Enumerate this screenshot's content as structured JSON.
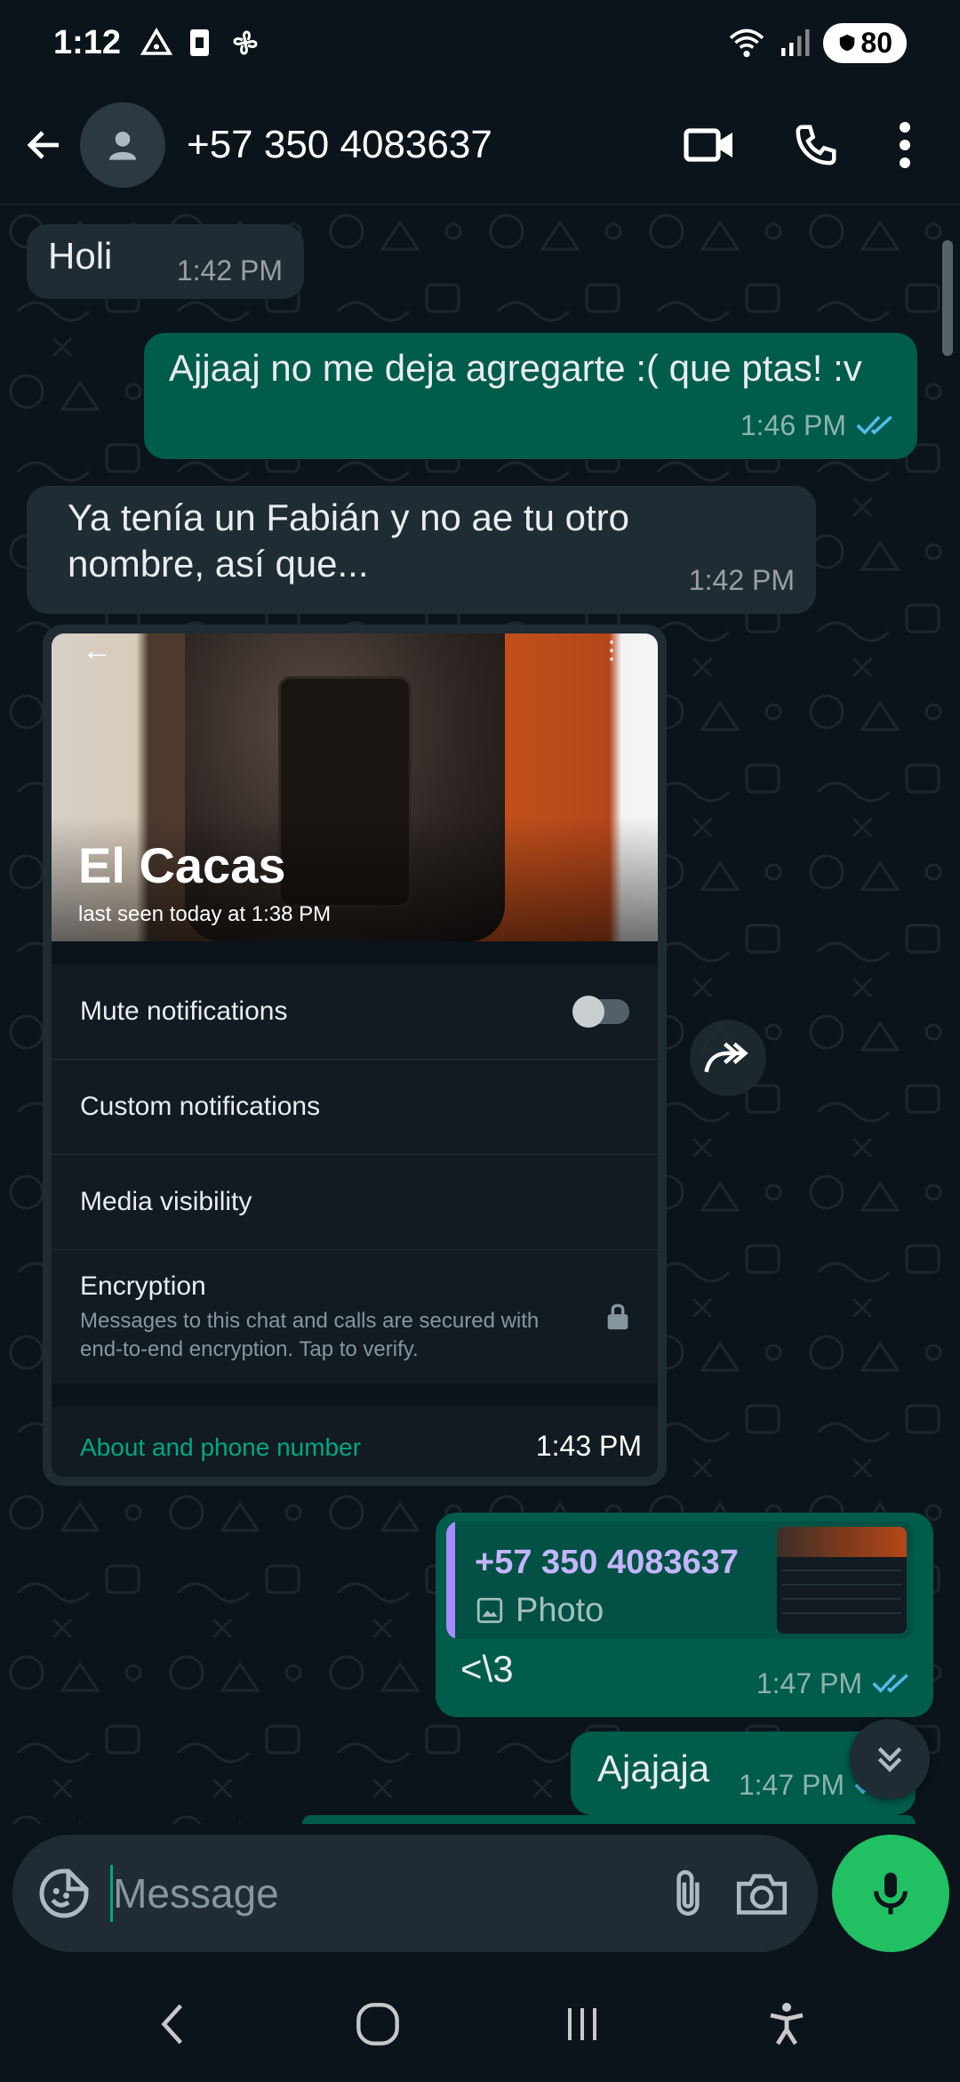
{
  "status_bar": {
    "time": "1:12",
    "battery": "80",
    "signal_label": "5"
  },
  "header": {
    "contact_name": "+57 350 4083637"
  },
  "colors": {
    "background": "#0b141a",
    "incoming": "#202c33",
    "outgoing": "#005c4b",
    "accent": "#00a884",
    "read_ticks": "#53bdeb"
  },
  "messages": [
    {
      "direction": "in",
      "text": "Holi",
      "time": "1:42 PM"
    },
    {
      "direction": "out",
      "text": "Ajjaaj no me deja agregarte :( que ptas! :v",
      "time": "1:46 PM",
      "status": "read"
    },
    {
      "direction": "in",
      "text": "Ya tenía un Fabián y no ae tu otro nombre, así que...",
      "time": "1:42 PM"
    },
    {
      "direction": "in",
      "type": "image",
      "time": "1:43 PM",
      "screenshot": {
        "profile_name": "El Cacas",
        "last_seen": "last seen today at 1:38 PM",
        "rows": [
          "Mute notifications",
          "Custom notifications",
          "Media visibility"
        ],
        "encryption_title": "Encryption",
        "encryption_desc": "Messages to this chat and calls are secured with end-to-end encryption. Tap to verify.",
        "about": "About and phone number"
      }
    },
    {
      "direction": "out",
      "text": "<\\3",
      "time": "1:47 PM",
      "status": "read",
      "quote": {
        "name": "+57 350 4083637",
        "type": "Photo"
      }
    },
    {
      "direction": "out",
      "text": "Ajajaja",
      "time": "1:47 PM",
      "status": "read"
    }
  ],
  "composer": {
    "placeholder": "Message"
  }
}
